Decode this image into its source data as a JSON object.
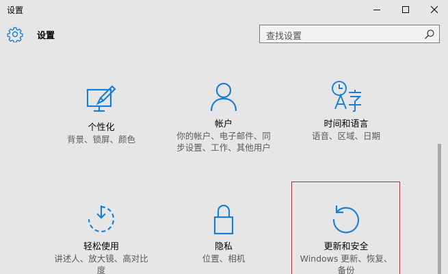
{
  "window": {
    "title": "设置",
    "controls": {
      "minimize": "minimize-icon",
      "maximize": "maximize-icon",
      "close": "close-icon"
    }
  },
  "header": {
    "title": "设置",
    "icon": "gear-icon",
    "search_placeholder": "查找设置",
    "search_icon": "search-icon"
  },
  "accent_color": "#1a7fd4",
  "highlight_color": "#e0161b",
  "tiles": [
    {
      "name": "个性化",
      "desc": "背景、锁屏、颜色",
      "icon": "personalization-icon"
    },
    {
      "name": "帐户",
      "desc": "你的帐户、电子邮件、同步设置、工作、其他用户",
      "icon": "accounts-icon"
    },
    {
      "name": "时间和语言",
      "desc": "语音、区域、日期",
      "icon": "time-language-icon"
    },
    {
      "name": "轻松使用",
      "desc": "讲述人、放大镜、高对比度",
      "icon": "ease-of-access-icon"
    },
    {
      "name": "隐私",
      "desc": "位置、相机",
      "icon": "privacy-icon"
    },
    {
      "name": "更新和安全",
      "desc": "Windows 更新、恢复、备份",
      "icon": "update-security-icon"
    }
  ]
}
